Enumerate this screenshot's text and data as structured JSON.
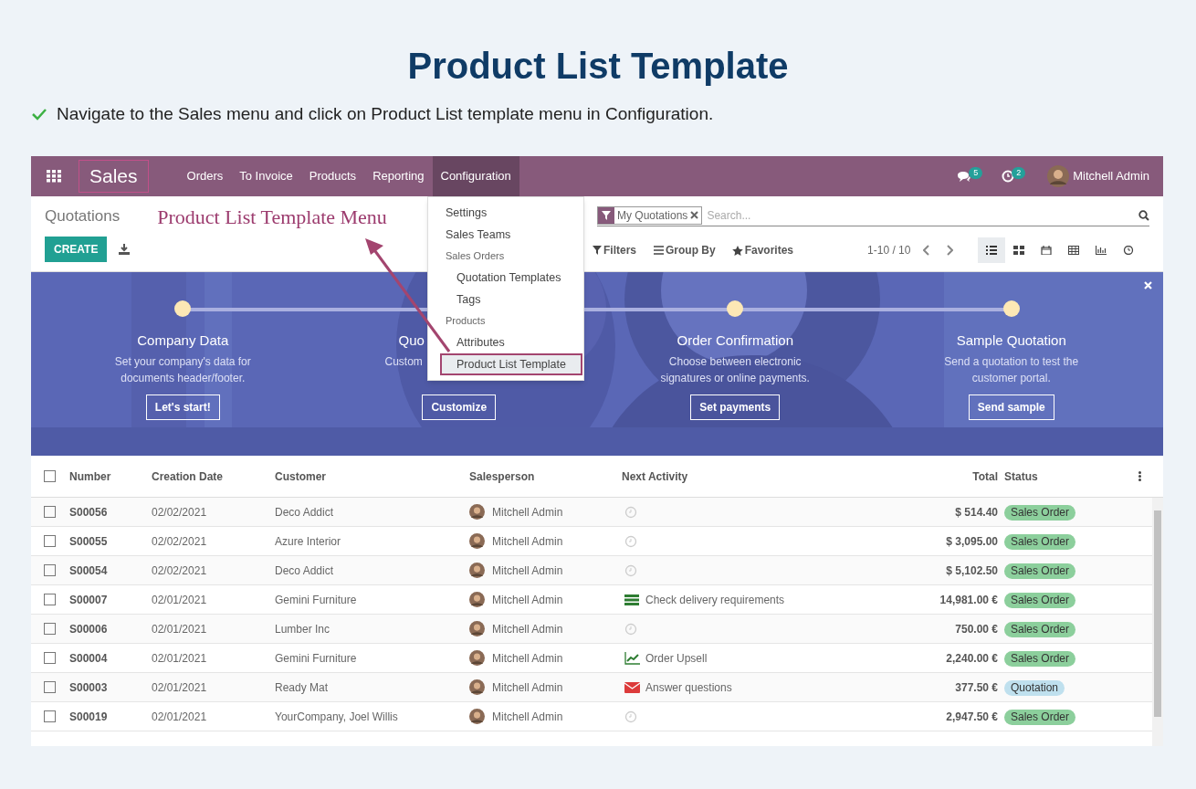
{
  "title": "Product List Template",
  "instruction": "Navigate to the Sales menu and click on Product List template menu in Configuration.",
  "navbar": {
    "app_name": "Sales",
    "menu": [
      {
        "label": "Orders",
        "selected": false
      },
      {
        "label": "To Invoice",
        "selected": false
      },
      {
        "label": "Products",
        "selected": false
      },
      {
        "label": "Reporting",
        "selected": false
      },
      {
        "label": "Configuration",
        "selected": true
      }
    ],
    "messages_count": "5",
    "activities_count": "2",
    "user": "Mitchell Admin"
  },
  "dropdown": [
    {
      "kind": "item",
      "label": "Settings",
      "selected": false
    },
    {
      "kind": "item",
      "label": "Sales Teams",
      "selected": false
    },
    {
      "kind": "header",
      "label": "Sales Orders"
    },
    {
      "kind": "subitem",
      "label": "Quotation Templates",
      "selected": false
    },
    {
      "kind": "subitem",
      "label": "Tags",
      "selected": false
    },
    {
      "kind": "header",
      "label": "Products"
    },
    {
      "kind": "subitem",
      "label": "Attributes",
      "selected": false
    },
    {
      "kind": "subitem",
      "label": "Product List Template",
      "selected": true
    }
  ],
  "annotation": "Product List Template Menu",
  "control_panel": {
    "breadcrumb": "Quotations",
    "create": "CREATE",
    "facet": "My Quotations",
    "search_placeholder": "Search...",
    "filters": "Filters",
    "group_by": "Group By",
    "favorites": "Favorites",
    "pager": "1-10 / 10",
    "views": [
      {
        "kind": "list",
        "selected": true
      },
      {
        "kind": "kanban",
        "selected": false
      },
      {
        "kind": "calendar",
        "selected": false
      },
      {
        "kind": "pivot",
        "selected": false
      },
      {
        "kind": "graph",
        "selected": false
      },
      {
        "kind": "activity",
        "selected": false
      }
    ]
  },
  "hero": {
    "steps": [
      {
        "kind": "full",
        "title": "Company Data",
        "description": "Set your company's data for documents header/footer.",
        "button": "Let's start!"
      },
      {
        "kind": "partial",
        "title": "Quo",
        "description": "Custom",
        "button": "Customize"
      },
      {
        "kind": "full",
        "title": "Order Confirmation",
        "description": "Choose between electronic signatures or online payments.",
        "button": "Set payments"
      },
      {
        "kind": "full",
        "title": "Sample Quotation",
        "description": "Send a quotation to test the customer portal.",
        "button": "Send sample"
      }
    ]
  },
  "table": {
    "all_checked": false,
    "columns": [
      "Number",
      "Creation Date",
      "Customer",
      "Salesperson",
      "Next Activity",
      "Total",
      "Status"
    ],
    "rows": [
      {
        "checked": false,
        "number": "S00056",
        "date": "02/02/2021",
        "customer": "Deco Addict",
        "salesperson": "Mitchell Admin",
        "activity": {
          "kind": "none"
        },
        "total": "$ 514.40",
        "status": {
          "kind": "order",
          "label": "Sales Order"
        }
      },
      {
        "checked": false,
        "number": "S00055",
        "date": "02/02/2021",
        "customer": "Azure Interior",
        "salesperson": "Mitchell Admin",
        "activity": {
          "kind": "none"
        },
        "total": "$ 3,095.00",
        "status": {
          "kind": "order",
          "label": "Sales Order"
        }
      },
      {
        "checked": false,
        "number": "S00054",
        "date": "02/02/2021",
        "customer": "Deco Addict",
        "salesperson": "Mitchell Admin",
        "activity": {
          "kind": "none"
        },
        "total": "$ 5,102.50",
        "status": {
          "kind": "order",
          "label": "Sales Order"
        }
      },
      {
        "checked": false,
        "number": "S00007",
        "date": "02/01/2021",
        "customer": "Gemini Furniture",
        "salesperson": "Mitchell Admin",
        "activity": {
          "kind": "todo",
          "text": "Check delivery requirements"
        },
        "total": "14,981.00 €",
        "status": {
          "kind": "order",
          "label": "Sales Order"
        }
      },
      {
        "checked": false,
        "number": "S00006",
        "date": "02/01/2021",
        "customer": "Lumber Inc",
        "salesperson": "Mitchell Admin",
        "activity": {
          "kind": "none"
        },
        "total": "750.00 €",
        "status": {
          "kind": "order",
          "label": "Sales Order"
        }
      },
      {
        "checked": false,
        "number": "S00004",
        "date": "02/01/2021",
        "customer": "Gemini Furniture",
        "salesperson": "Mitchell Admin",
        "activity": {
          "kind": "upsell",
          "text": "Order Upsell"
        },
        "total": "2,240.00 €",
        "status": {
          "kind": "order",
          "label": "Sales Order"
        }
      },
      {
        "checked": false,
        "number": "S00003",
        "date": "02/01/2021",
        "customer": "Ready Mat",
        "salesperson": "Mitchell Admin",
        "activity": {
          "kind": "email",
          "text": "Answer questions"
        },
        "total": "377.50 €",
        "status": {
          "kind": "quotation",
          "label": "Quotation"
        }
      },
      {
        "checked": false,
        "number": "S00019",
        "date": "02/01/2021",
        "customer": "YourCompany, Joel Willis",
        "salesperson": "Mitchell Admin",
        "activity": {
          "kind": "none"
        },
        "total": "2,947.50 €",
        "status": {
          "kind": "order",
          "label": "Sales Order"
        }
      }
    ]
  }
}
